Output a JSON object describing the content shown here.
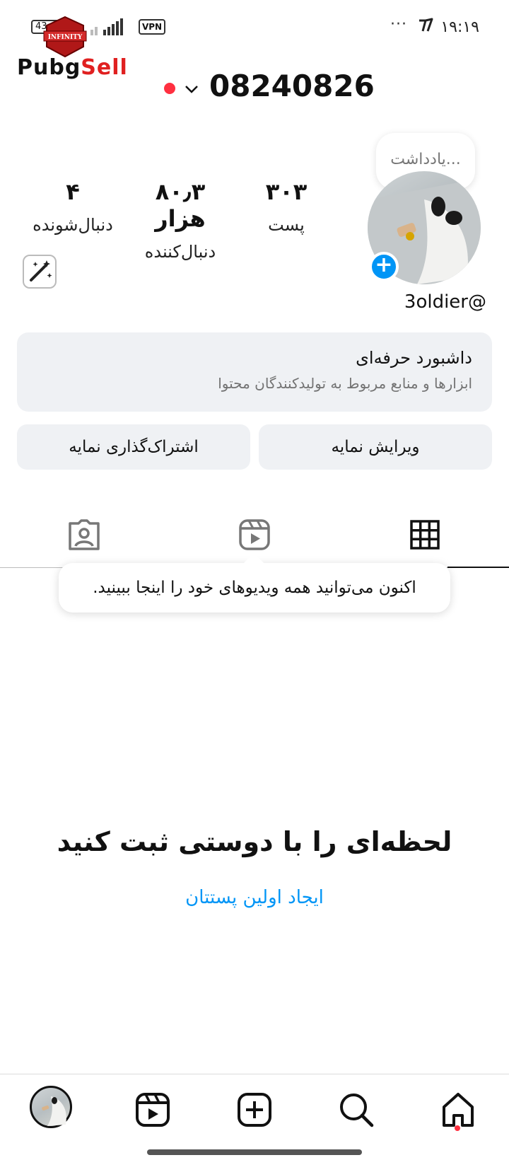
{
  "status_bar": {
    "time": "۱۹:۱۹",
    "battery": "43",
    "vpn_label": "VPN",
    "more_dots": "···"
  },
  "watermark": {
    "badge_text": "INFINITY",
    "text_part1": "Pubg",
    "text_part2": "Sell"
  },
  "header": {
    "username": "08240826"
  },
  "note": {
    "placeholder": "یادداشت..."
  },
  "stats": {
    "posts": {
      "value": "۳۰۳",
      "label": "پست"
    },
    "followers": {
      "value": "۸۰٫۳ هزار",
      "label": "دنبال‌کننده"
    },
    "following": {
      "value": "۴",
      "label": "دنبال‌شونده"
    }
  },
  "profile": {
    "handle": "3oldier@"
  },
  "dashboard": {
    "title": "داشبورد حرفه‌ای",
    "subtitle": "ابزارها و منابع مربوط به تولیدکنندگان محتوا"
  },
  "buttons": {
    "edit": "ویرایش نمایه",
    "share": "اشتراک‌گذاری نمایه"
  },
  "tabs": {
    "items": [
      "grid-icon",
      "reels-icon",
      "tagged-icon"
    ],
    "active": "grid-icon"
  },
  "tooltip": {
    "text": "اکنون می‌توانید همه ویدیوهای خود را اینجا ببینید."
  },
  "empty_state": {
    "title": "لحظه‌ای را با دوستی ثبت کنید",
    "link": "ایجاد اولین پستتان"
  },
  "bottom_nav": {
    "items": [
      "profile-avatar",
      "reels-icon",
      "create-icon",
      "search-icon",
      "home-icon"
    ],
    "active": "home-icon"
  },
  "colors": {
    "accent_blue": "#0095f6",
    "notification_red": "#ff3040",
    "card_bg": "#eff1f4"
  }
}
